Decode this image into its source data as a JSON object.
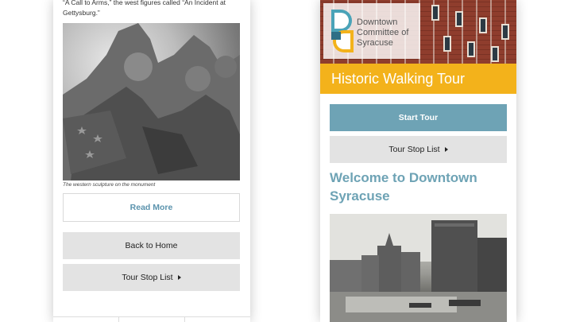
{
  "left_screen": {
    "intro_text": "“A Call to Arms,” the west figures called “An Incident at Gettysburg.”",
    "image_caption": "The western sculpture on the monument",
    "read_more_label": "Read More",
    "back_home_label": "Back to Home",
    "tour_stop_list_label": "Tour Stop List"
  },
  "right_screen": {
    "logo_text": [
      "Downtown",
      "Committee of",
      "Syracuse"
    ],
    "banner_title": "Historic Walking Tour",
    "start_tour_label": "Start Tour",
    "tour_stop_list_label": "Tour Stop List",
    "welcome_heading": "Welcome to Downtown Syracuse"
  },
  "colors": {
    "accent_blue": "#6ea3b5",
    "banner_yellow": "#f3b21b",
    "button_grey": "#e3e3e3",
    "logo_teal": "#4aa3b8",
    "logo_yellow": "#f3b21b"
  },
  "icons": [
    "caret-right-icon",
    "dcs-logo-mark"
  ]
}
